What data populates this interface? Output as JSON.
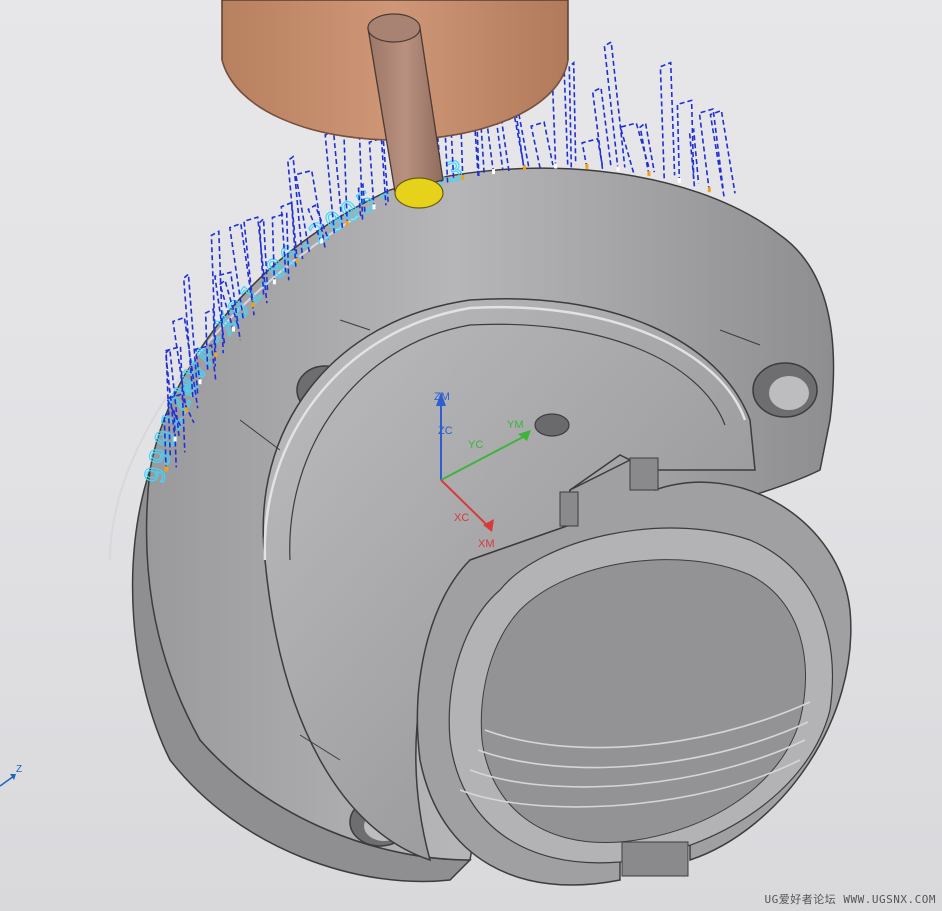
{
  "viewport": {
    "background_top": "#e7e7e9",
    "background_bottom": "#d9d9dc"
  },
  "part": {
    "body_color": "#a9a9ab",
    "edge_color": "#3c3c3c",
    "engraving_text": "9901ZWVA-X01-06-2005-0143",
    "engraving_color": "#3fd7ff",
    "engraving_segments": [
      "9901",
      "ZWVA",
      "-X01",
      "-06-",
      "2005",
      "-0143"
    ]
  },
  "tool": {
    "holder_color": "#c78e6f",
    "shank_color": "#b48570",
    "tip_color": "#e6d21a"
  },
  "toolpath": {
    "color": "#1f2fd6",
    "style": "dashed"
  },
  "csys": {
    "labels": [
      "ZM",
      "ZC",
      "YC",
      "YM",
      "XC",
      "XM"
    ],
    "z_color": "#2d5fd0",
    "y_color": "#3db43d",
    "x_color": "#d83a3a",
    "zm": "ZM",
    "zc": "ZC",
    "yc": "YC",
    "ym": "YM",
    "xc": "XC",
    "xm": "XM"
  },
  "view_triad": {
    "z_label": "Z",
    "icon": "view-triad-icon"
  },
  "watermark": {
    "text": "UG爱好者论坛 WWW.UGSNX.COM"
  }
}
